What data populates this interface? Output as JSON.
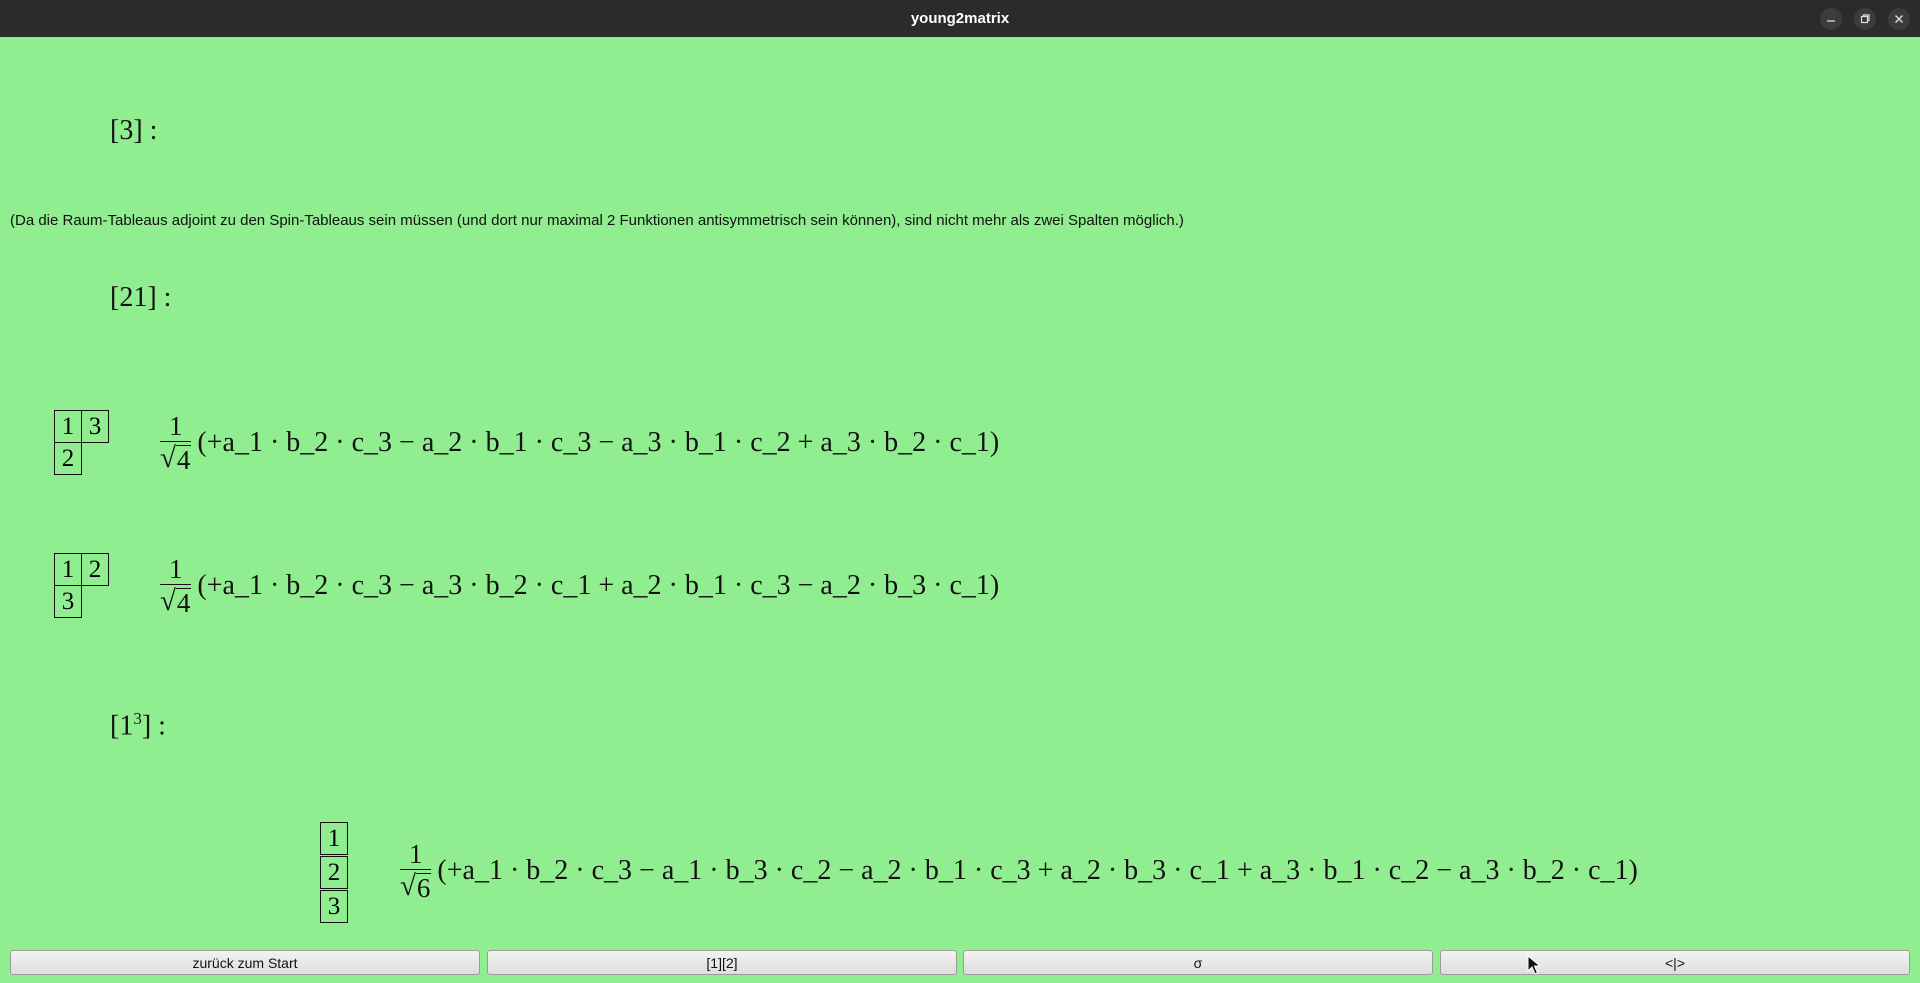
{
  "window": {
    "title": "young2matrix"
  },
  "sections": {
    "s3": {
      "heading_main": "[3] :"
    },
    "note": "(Da die Raum-Tableaus adjoint zu den Spin-Tableaus sein müssen (und dort nur maximal 2 Funktionen antisymmetrisch sein können), sind nicht mehr als zwei Spalten möglich.)",
    "s21": {
      "heading_main": "[21] :",
      "entries": [
        {
          "tableau": {
            "r1c1": "1",
            "r1c2": "3",
            "r2c1": "2"
          },
          "numerator": "1",
          "radicand": "4",
          "expression": "(+a_1 · b_2 · c_3 − a_2 · b_1 · c_3 − a_3 · b_1 · c_2 + a_3 · b_2 · c_1)"
        },
        {
          "tableau": {
            "r1c1": "1",
            "r1c2": "2",
            "r2c1": "3"
          },
          "numerator": "1",
          "radicand": "4",
          "expression": "(+a_1 · b_2 · c_3 − a_3 · b_2 · c_1 + a_2 · b_1 · c_3 − a_2 · b_3 · c_1)"
        }
      ]
    },
    "s111": {
      "heading_base": "[1",
      "heading_sup": "3",
      "heading_tail": "] :",
      "entries": [
        {
          "tableau": {
            "r1c1": "1",
            "r2c1": "2",
            "r3c1": "3"
          },
          "numerator": "1",
          "radicand": "6",
          "expression": "(+a_1 · b_2 · c_3 − a_1 · b_3 · c_2 − a_2 · b_1 · c_3 + a_2 · b_3 · c_1 + a_3 · b_1 · c_2 − a_3 · b_2 · c_1)"
        }
      ]
    }
  },
  "buttons": {
    "back": "zurück zum Start",
    "perm": "[1][2]",
    "sigma": "σ",
    "braket": "<|>"
  },
  "icons": {
    "minimize": "minimize-icon",
    "maximize": "maximize-icon",
    "close": "close-icon",
    "cursor": "mouse-pointer-icon"
  },
  "colors": {
    "background": "#90ee90",
    "titlebar": "#2b2b2b"
  }
}
